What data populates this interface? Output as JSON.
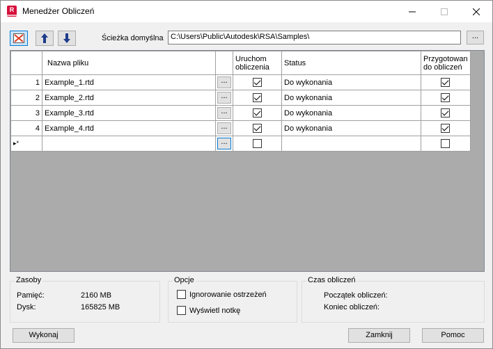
{
  "window": {
    "title": "Menedżer Obliczeń"
  },
  "toolbar": {
    "path_label": "Ścieżka domyślna",
    "path_value": "C:\\Users\\Public\\Autodesk\\RSA\\Samples\\",
    "browse_label": "..."
  },
  "grid": {
    "headers": {
      "name": "Nazwa pliku",
      "run": "Uruchom obliczenia",
      "status": "Status",
      "prepared": "Przygotowan do obliczeń"
    },
    "rows": [
      {
        "num": "1",
        "name": "Example_1.rtd",
        "btn": "...",
        "run": true,
        "status": "Do wykonania",
        "prepared": true
      },
      {
        "num": "2",
        "name": "Example_2.rtd",
        "btn": "...",
        "run": true,
        "status": "Do wykonania",
        "prepared": true
      },
      {
        "num": "3",
        "name": "Example_3.rtd",
        "btn": "...",
        "run": true,
        "status": "Do wykonania",
        "prepared": true
      },
      {
        "num": "4",
        "name": "Example_4.rtd",
        "btn": "...",
        "run": true,
        "status": "Do wykonania",
        "prepared": true
      }
    ],
    "new_row": {
      "marker": "▸*",
      "btn": "...",
      "run": false,
      "prepared": false
    }
  },
  "resources": {
    "title": "Zasoby",
    "memory_label": "Pamięć:",
    "memory_value": "2160 MB",
    "disk_label": "Dysk:",
    "disk_value": "165825 MB"
  },
  "options": {
    "title": "Opcje",
    "ignore_warnings": "Ignorowanie ostrzeżeń",
    "show_note": "Wyświetl notkę"
  },
  "time": {
    "title": "Czas obliczeń",
    "start_label": "Początek obliczeń:",
    "end_label": "Koniec obliczeń:"
  },
  "buttons": {
    "execute": "Wykonaj",
    "close": "Zamknij",
    "help": "Pomoc"
  }
}
